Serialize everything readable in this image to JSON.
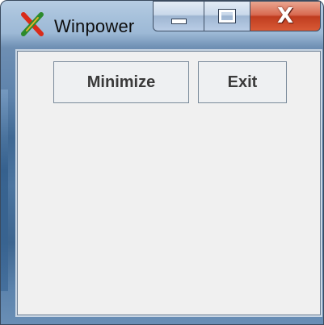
{
  "window": {
    "title": "Winpower",
    "app_icon": "winpower-x-icon",
    "caption": {
      "minimize_icon": "minimize-icon",
      "maximize_icon": "maximize-icon",
      "close_glyph": "X"
    }
  },
  "content": {
    "minimize_label": "Minimize",
    "exit_label": "Exit"
  }
}
